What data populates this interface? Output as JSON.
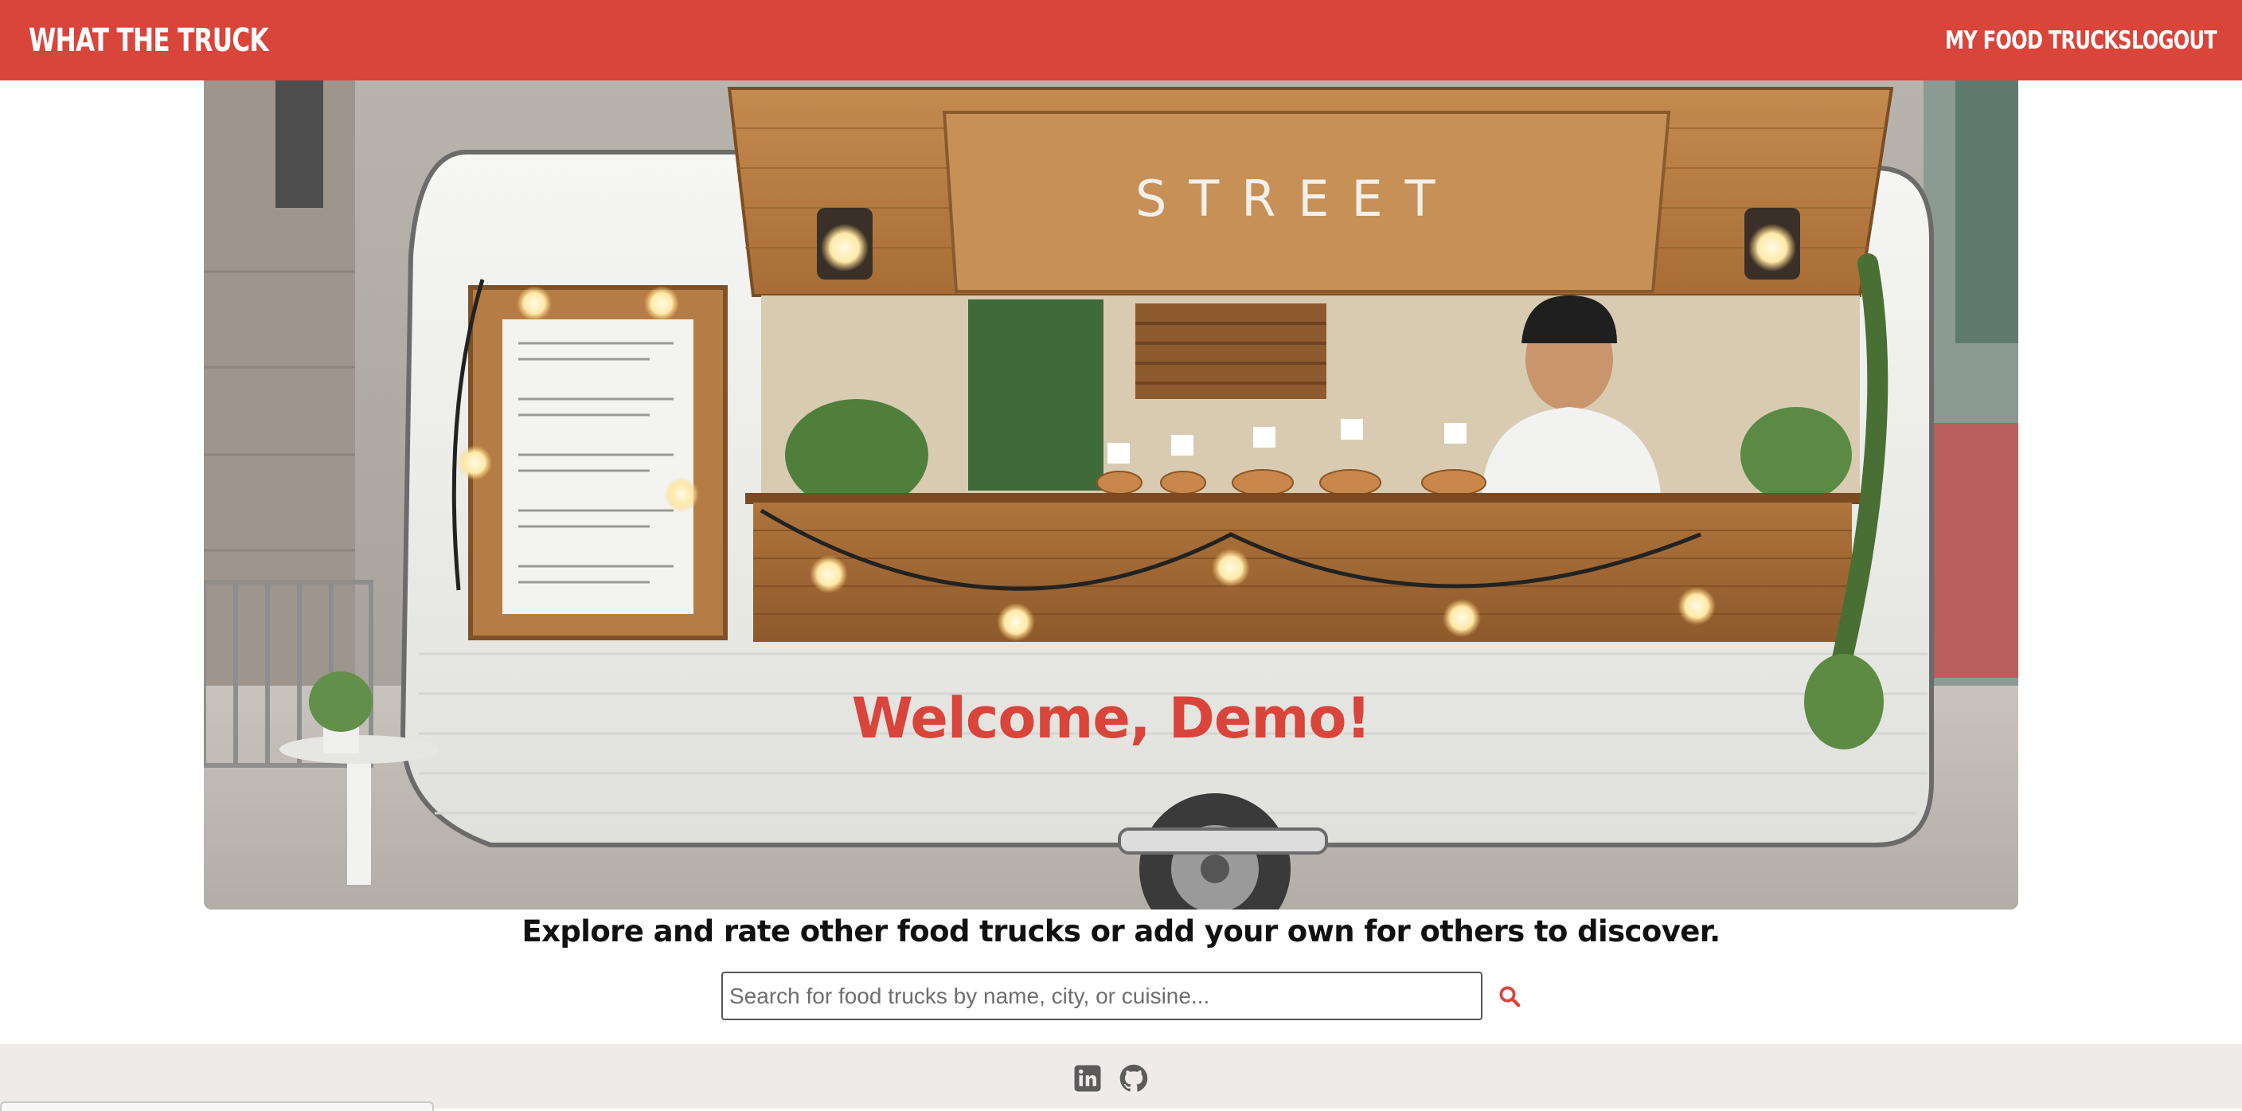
{
  "navbar": {
    "brand": "WHAT THE TRUCK",
    "links": [
      {
        "label": "MY FOOD TRUCKS"
      },
      {
        "label": "LOGOUT"
      }
    ],
    "color": "#d9443b"
  },
  "hero": {
    "sign_text": "STREET",
    "welcome": "Welcome, Demo!"
  },
  "tagline": "Explore and rate other food trucks or add your own for others to discover.",
  "search": {
    "value": "",
    "placeholder": "Search for food trucks by name, city, or cuisine...",
    "icon": "search-icon"
  },
  "footer": {
    "icons": [
      "linkedin-icon",
      "github-icon"
    ]
  }
}
